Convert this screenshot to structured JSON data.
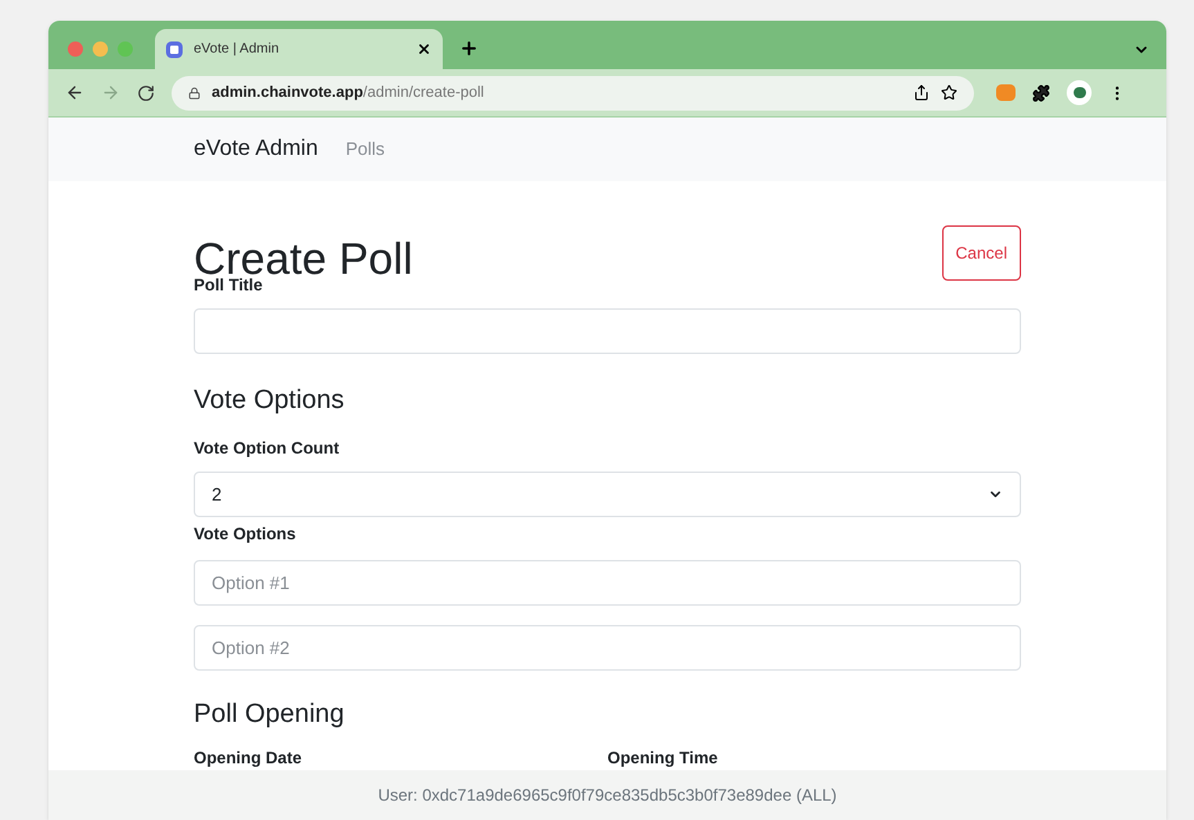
{
  "browser": {
    "tab_title": "eVote | Admin",
    "url_host": "admin.chainvote.app",
    "url_path": "/admin/create-poll"
  },
  "navbar": {
    "brand": "eVote Admin",
    "links": [
      {
        "label": "Polls"
      }
    ]
  },
  "page": {
    "title": "Create Poll",
    "cancel_button": "Cancel",
    "poll_title": {
      "label": "Poll Title"
    },
    "vote_options_heading": "Vote Options",
    "option_count": {
      "label": "Vote Option Count",
      "value": "2"
    },
    "vote_options": {
      "label": "Vote Options",
      "fields": [
        {
          "placeholder": "Option #1"
        },
        {
          "placeholder": "Option #2"
        }
      ]
    },
    "opening_heading": "Poll Opening",
    "opening_date": {
      "label": "Opening Date"
    },
    "opening_time": {
      "label": "Opening Time"
    }
  },
  "footer": {
    "text": "User: 0xdc71a9de6965c9f0f79ce835db5c3b0f73e89dee (ALL)"
  }
}
